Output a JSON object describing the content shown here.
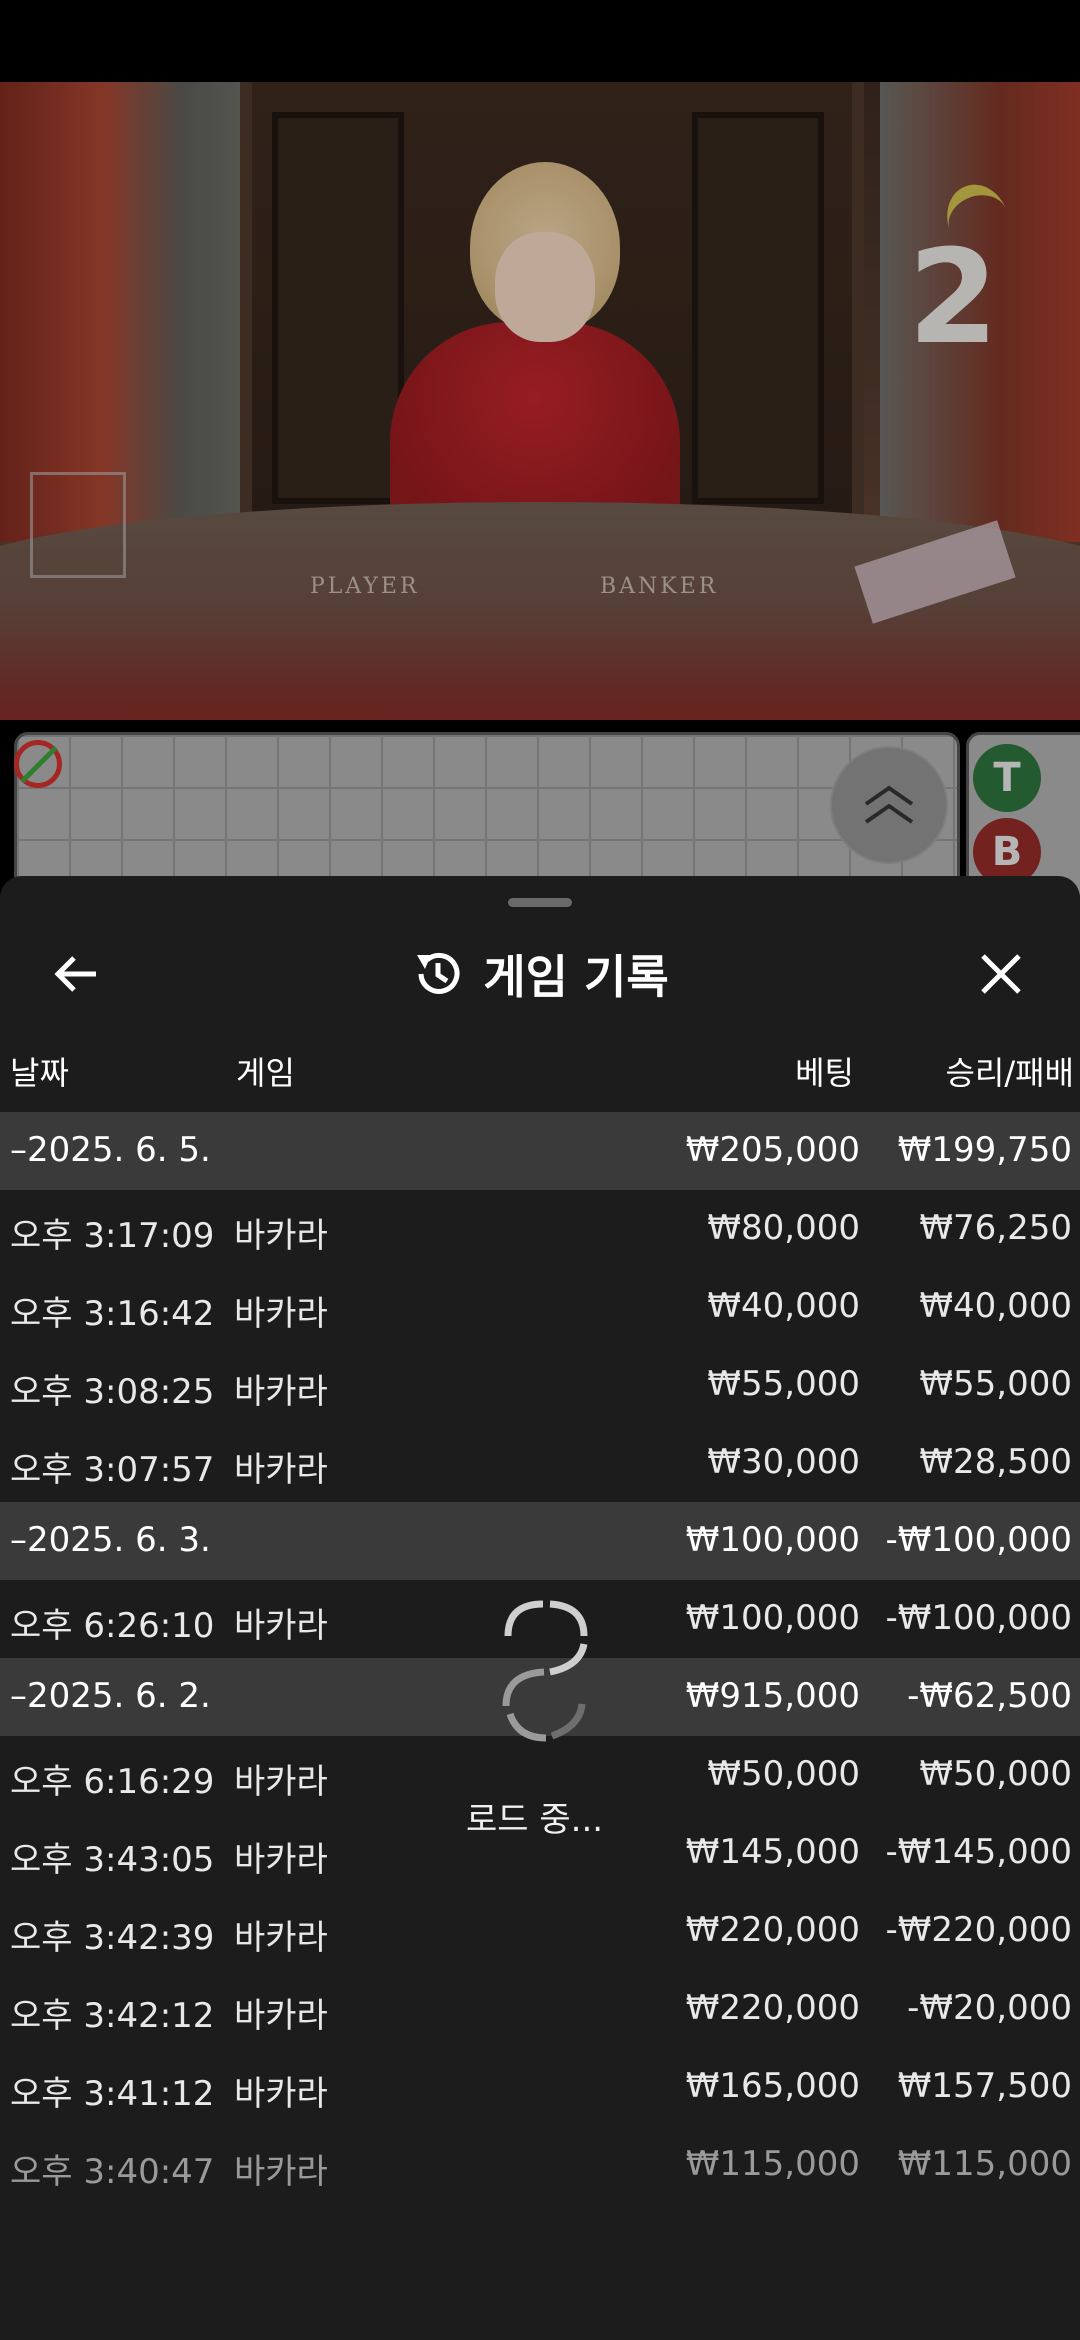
{
  "video": {
    "round_number": "2",
    "felt_player": "PLAYER",
    "felt_banker": "BANKER"
  },
  "scoreboard": {
    "badge_t": "T",
    "badge_b": "B"
  },
  "sheet": {
    "title": "게임 기록",
    "columns": {
      "date": "날짜",
      "game": "게임",
      "bet": "베팅",
      "win_loss": "승리/패배"
    },
    "loading": "로드 중..."
  },
  "rows": [
    {
      "type": "group",
      "date": "–2025. 6. 5.",
      "game": "",
      "bet": "₩205,000",
      "win": "₩199,750"
    },
    {
      "type": "item",
      "date": "오후 3:17:09",
      "game": "바카라",
      "bet": "₩80,000",
      "win": "₩76,250"
    },
    {
      "type": "item",
      "date": "오후 3:16:42",
      "game": "바카라",
      "bet": "₩40,000",
      "win": "₩40,000"
    },
    {
      "type": "item",
      "date": "오후 3:08:25",
      "game": "바카라",
      "bet": "₩55,000",
      "win": "₩55,000"
    },
    {
      "type": "item",
      "date": "오후 3:07:57",
      "game": "바카라",
      "bet": "₩30,000",
      "win": "₩28,500"
    },
    {
      "type": "group",
      "date": "–2025. 6. 3.",
      "game": "",
      "bet": "₩100,000",
      "win": "-₩100,000"
    },
    {
      "type": "item",
      "date": "오후 6:26:10",
      "game": "바카라",
      "bet": "₩100,000",
      "win": "-₩100,000"
    },
    {
      "type": "group",
      "date": "–2025. 6. 2.",
      "game": "",
      "bet": "₩915,000",
      "win": "-₩62,500"
    },
    {
      "type": "item",
      "date": "오후 6:16:29",
      "game": "바카라",
      "bet": "₩50,000",
      "win": "₩50,000"
    },
    {
      "type": "item",
      "date": "오후 3:43:05",
      "game": "바카라",
      "bet": "₩145,000",
      "win": "-₩145,000"
    },
    {
      "type": "item",
      "date": "오후 3:42:39",
      "game": "바카라",
      "bet": "₩220,000",
      "win": "-₩220,000"
    },
    {
      "type": "item",
      "date": "오후 3:42:12",
      "game": "바카라",
      "bet": "₩220,000",
      "win": "-₩20,000"
    },
    {
      "type": "item",
      "date": "오후 3:41:12",
      "game": "바카라",
      "bet": "₩165,000",
      "win": "₩157,500"
    },
    {
      "type": "item",
      "date": "오후 3:40:47",
      "game": "바카라",
      "bet": "₩115,000",
      "win": "₩115,000",
      "faded": true
    }
  ]
}
